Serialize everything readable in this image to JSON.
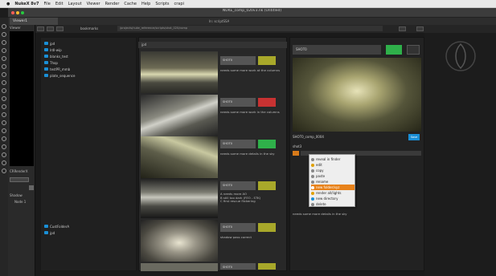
{
  "menubar": {
    "apple": "",
    "app": "NukeX 8v7",
    "items": [
      "File",
      "Edit",
      "Layout",
      "Viewer",
      "Render",
      "Cache",
      "Help",
      "Scripts",
      "crapi"
    ]
  },
  "window": {
    "title": "NUKE_comp_020v3.nk (Untitled)",
    "tab": "Viewer1",
    "subtitle": "In: scriptSSA"
  },
  "left": {
    "label1": "Viewer",
    "label2": "CRRenderX",
    "label3": "Shadow",
    "label4": "Node 1"
  },
  "toolbar": {
    "bookmarks": "bookmarks",
    "path": "/projects/nuke_reference/scripts/shot_020/comp"
  },
  "folders": [
    "jpd",
    "lrdl-wip",
    "blanks_test",
    "Thop",
    "testPR_mmb",
    "plate_sequence"
  ],
  "folders_bottom": [
    "CustFolderA",
    "jpd"
  ],
  "grid": {
    "header": "jpd",
    "items": [
      {
        "name": "SHOT0",
        "note": "needs some more work at the columns",
        "color": "#a8a82a"
      },
      {
        "name": "SHOT0",
        "note": "needs some more work in the columns",
        "color": "#c83232"
      },
      {
        "name": "SHOT0",
        "note": "needs some more details in the sky",
        "color": "#2fb04a"
      },
      {
        "name": "SHOT0",
        "note": "A needs more AO\nB still too dark (FEO - STK)\nC first rescue flickering",
        "color": "#a8a82a"
      },
      {
        "name": "SHOT0",
        "note": "shadow pass correct",
        "color": "#a8a82a"
      },
      {
        "name": "SHOT0",
        "note": "",
        "color": "#a8a82a"
      }
    ]
  },
  "right": {
    "name": "SHOT0",
    "swatch": "#2fb04a",
    "asset": "SHOT0_comp_0004",
    "save": "Save",
    "tags": "shot3",
    "note": "needs some more details in the sky"
  },
  "context_menu": [
    "reveal in finder",
    "edit",
    "copy",
    "paste",
    "rename",
    "new folder/xyz",
    "render all/lights",
    "new directory",
    "delete"
  ]
}
